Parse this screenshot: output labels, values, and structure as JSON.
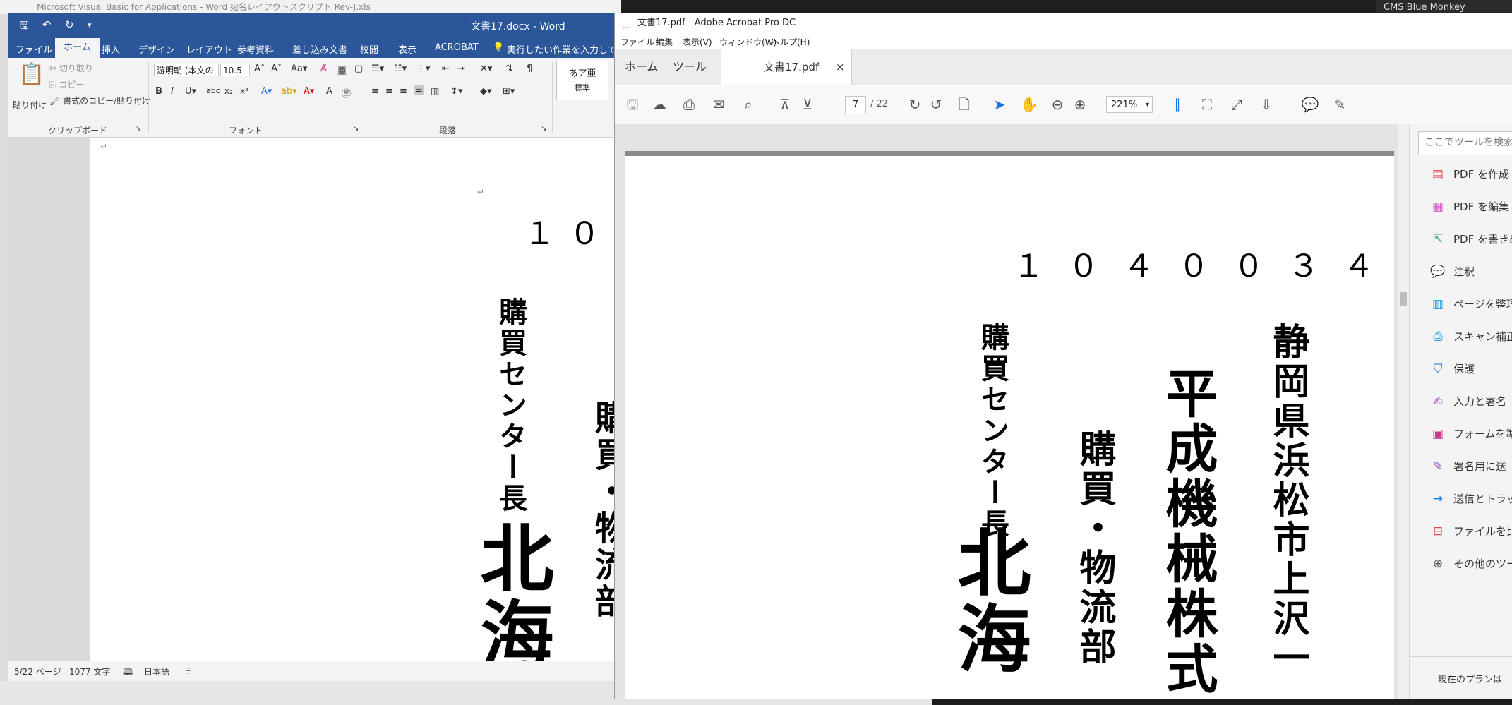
{
  "background": {
    "excel_title": "Microsoft Visual Basic for Applications - Word 宛名レイアウトスクリプト Rev-J.xls",
    "right_app": "CMS Blue Monkey"
  },
  "word": {
    "doc_title": "文書17.docx  -  Word",
    "tabs": [
      "ファイル",
      "ホーム",
      "挿入",
      "デザイン",
      "レイアウト",
      "参考資料",
      "差し込み文書",
      "校閲",
      "表示",
      "ACROBAT"
    ],
    "tell_me": "実行したい作業を入力してください",
    "clipboard": {
      "paste": "貼り付け",
      "cut": "切り取り",
      "copy": "コピー",
      "format_painter": "書式のコピー/貼り付け",
      "group": "クリップボード"
    },
    "font": {
      "name": "游明朝 (本文の",
      "size": "10.5",
      "group": "フォント"
    },
    "paragraph": {
      "group": "段落"
    },
    "styles": {
      "sample": "あア亜",
      "name": "標準"
    },
    "page": {
      "postal": "１０",
      "title_role": "購買センター長",
      "dept": "購買・物流部",
      "name": "北海"
    },
    "status": {
      "page": "5/22 ページ",
      "words": "1077 文字",
      "lang": "日本語"
    }
  },
  "acrobat": {
    "title": "文書17.pdf - Adobe Acrobat Pro DC",
    "menu": [
      "ファイル",
      "編集",
      "表示(V)",
      "ウィンドウ(W)",
      "ヘルプ(H)"
    ],
    "tabs": {
      "home": "ホーム",
      "tools": "ツール",
      "doc": "文書17.pdf"
    },
    "page_current": "7",
    "page_total": "/ 22",
    "zoom": "221%",
    "page": {
      "postal": "１ ０ ４ ０ ０ ３ ４",
      "address": "静岡県浜松市上沢一",
      "company": "平成機械株式",
      "dept": "購買・物流部",
      "title_role": "購買センター長",
      "name": "北海"
    },
    "sidebar": {
      "search_placeholder": "ここでツールを検索",
      "items": [
        {
          "label": "PDF を作成",
          "color": "#e34850",
          "icon": "pdf-create-icon",
          "glyph": "▤"
        },
        {
          "label": "PDF を編集",
          "color": "#d45bc6",
          "icon": "pdf-edit-icon",
          "glyph": "▦"
        },
        {
          "label": "PDF を書き出",
          "color": "#2d9d78",
          "icon": "pdf-export-icon",
          "glyph": "⇱"
        },
        {
          "label": "注釈",
          "color": "#f5b400",
          "icon": "comment-icon",
          "glyph": "💬"
        },
        {
          "label": "ページを整理",
          "color": "#1f9bde",
          "icon": "organize-pages-icon",
          "glyph": "▥"
        },
        {
          "label": "スキャン補正",
          "color": "#1f9bde",
          "icon": "scan-icon",
          "glyph": "⎙"
        },
        {
          "label": "保護",
          "color": "#1473e6",
          "icon": "protect-icon",
          "glyph": "⛉"
        },
        {
          "label": "入力と署名",
          "color": "#9c55d6",
          "icon": "fill-sign-icon",
          "glyph": "✍"
        },
        {
          "label": "フォームを準",
          "color": "#c23b8a",
          "icon": "form-icon",
          "glyph": "▣"
        },
        {
          "label": "署名用に送",
          "color": "#8c47c4",
          "icon": "send-sign-icon",
          "glyph": "✎"
        },
        {
          "label": "送信とトラッ",
          "color": "#1473e6",
          "icon": "send-track-icon",
          "glyph": "→"
        },
        {
          "label": "ファイルを比",
          "color": "#e34850",
          "icon": "compare-icon",
          "glyph": "⊟"
        },
        {
          "label": "その他のツー",
          "color": "#555555",
          "icon": "more-tools-icon",
          "glyph": "⊕"
        }
      ],
      "plan_text": "現在のプランは"
    }
  }
}
